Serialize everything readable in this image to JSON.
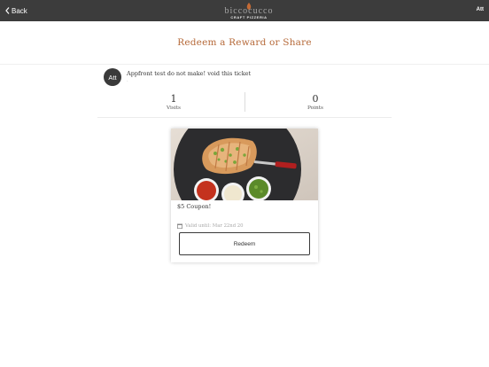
{
  "topbar": {
    "back_label": "Back",
    "logo_word": "bicco",
    "logo_word_right": "cucco",
    "logo_sub": "CRAFT PIZZERIA",
    "right_label": "Att"
  },
  "page": {
    "title": "Redeem a Reward or Share"
  },
  "ticket": {
    "avatar_initials": "Att",
    "message": "Appfront test do not make! void this ticket",
    "sub": "-"
  },
  "stats": {
    "visits": {
      "value": "1",
      "label": "Visits"
    },
    "points": {
      "value": "0",
      "label": "Points"
    }
  },
  "reward": {
    "title": "$5 Coupon!",
    "valid_until": "Valid until: Mar 22nd 20",
    "redeem_label": "Redeem"
  },
  "colors": {
    "topbar": "#3c3c3c",
    "accent": "#b66a3a"
  }
}
